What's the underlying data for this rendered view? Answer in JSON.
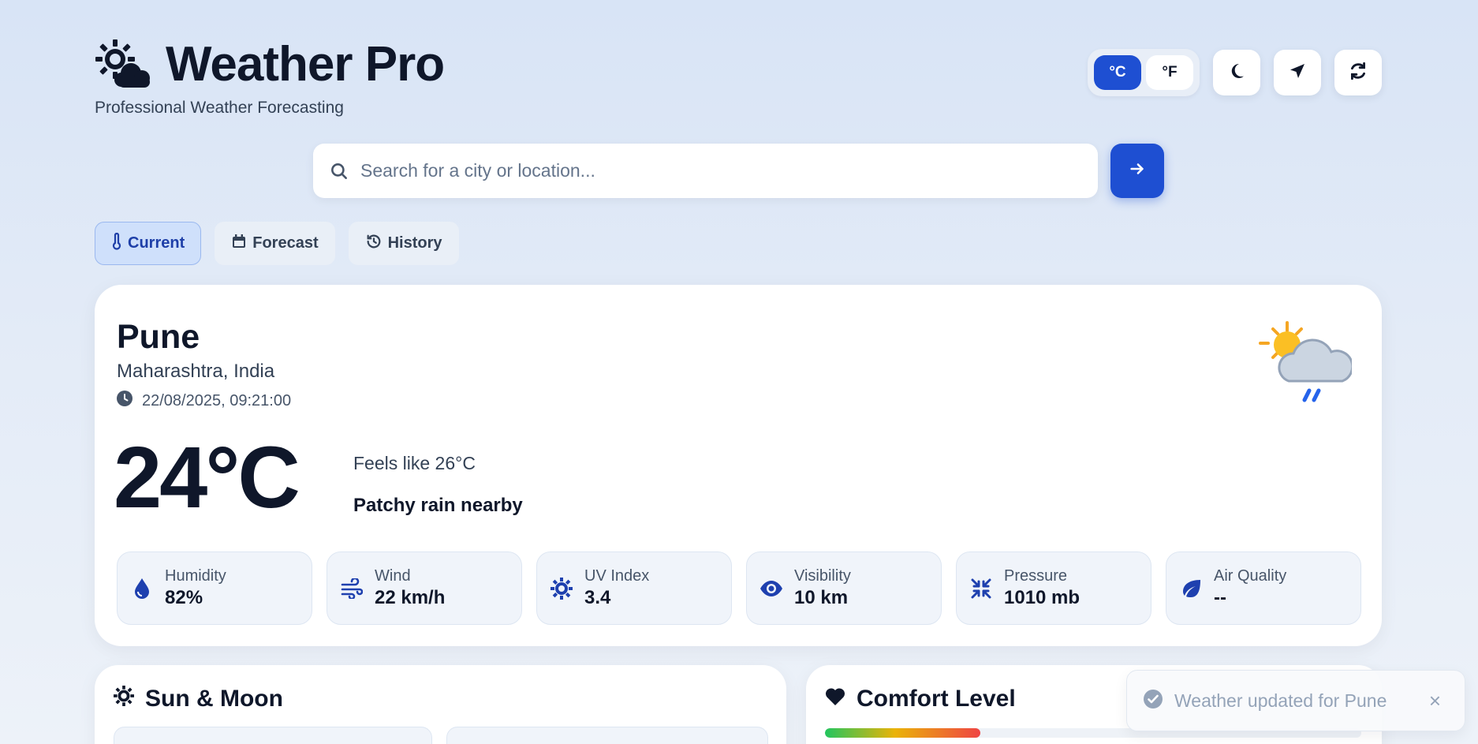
{
  "brand": {
    "title": "Weather Pro",
    "subtitle": "Professional Weather Forecasting"
  },
  "units": {
    "celsius": "°C",
    "fahrenheit": "°F",
    "selected": "°C"
  },
  "search": {
    "placeholder": "Search for a city or location...",
    "value": ""
  },
  "tabs": [
    {
      "label": "Current",
      "active": true
    },
    {
      "label": "Forecast",
      "active": false
    },
    {
      "label": "History",
      "active": false
    }
  ],
  "current": {
    "city": "Pune",
    "region": "Maharashtra, India",
    "datetime": "22/08/2025, 09:21:00",
    "temperature": "24°C",
    "feels_like": "Feels like 26°C",
    "condition": "Patchy rain nearby",
    "stats": [
      {
        "label": "Humidity",
        "value": "82%",
        "icon": "droplet-icon"
      },
      {
        "label": "Wind",
        "value": "22 km/h",
        "icon": "wind-icon"
      },
      {
        "label": "UV Index",
        "value": "3.4",
        "icon": "sun-icon"
      },
      {
        "label": "Visibility",
        "value": "10 km",
        "icon": "eye-icon"
      },
      {
        "label": "Pressure",
        "value": "1010 mb",
        "icon": "compress-icon"
      },
      {
        "label": "Air Quality",
        "value": "--",
        "icon": "leaf-icon"
      }
    ]
  },
  "sun_moon": {
    "title": "Sun & Moon"
  },
  "comfort": {
    "title": "Comfort Level",
    "level_fraction": 0.29
  },
  "toast": {
    "message": "Weather updated for Pune",
    "close": "×"
  },
  "colors": {
    "accent": "#1e4fd2",
    "text": "#0f172a",
    "muted": "#475569"
  }
}
